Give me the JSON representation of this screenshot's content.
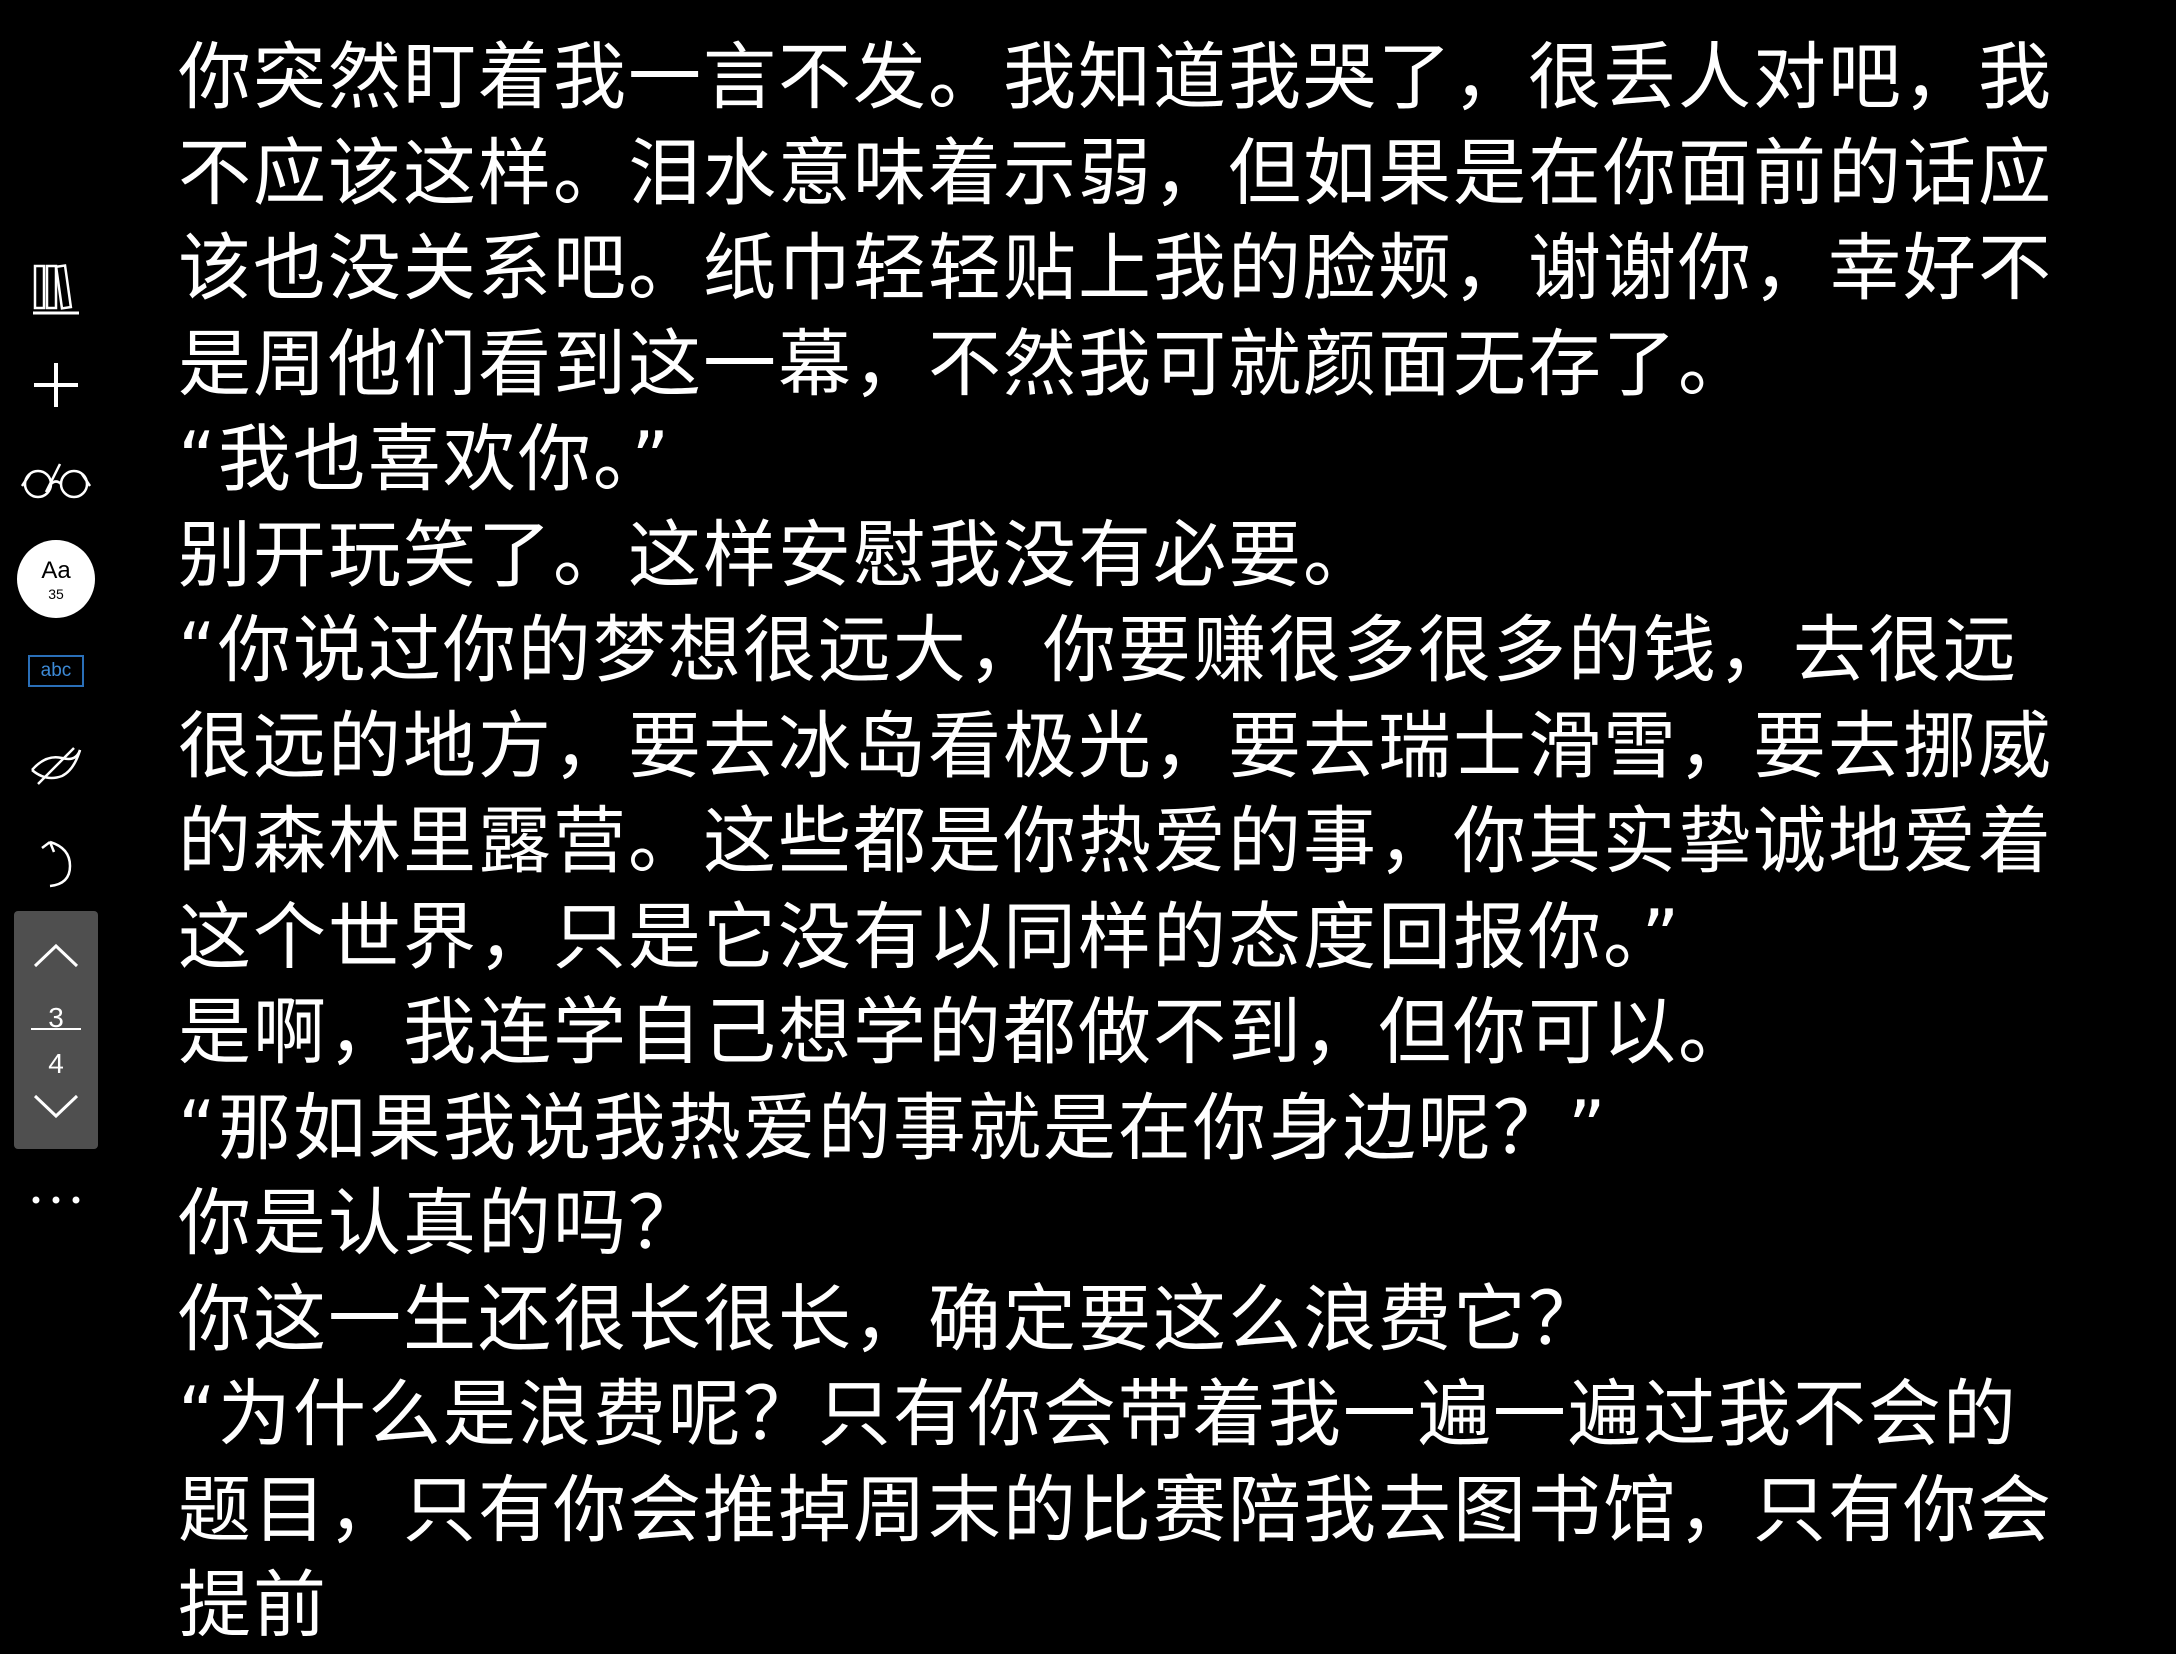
{
  "toolbar": {
    "items": [
      {
        "name": "library-icon"
      },
      {
        "name": "add-icon"
      },
      {
        "name": "glasses-icon"
      },
      {
        "name": "font-settings"
      },
      {
        "name": "abc-icon"
      },
      {
        "name": "annotate-icon"
      },
      {
        "name": "undo-icon"
      }
    ],
    "font_label": "Aa",
    "font_size": "35",
    "abc_label": "abc",
    "pager": {
      "current": "3",
      "total": "4"
    },
    "more_label": "···"
  },
  "content": {
    "paragraphs": [
      "你突然盯着我一言不发。我知道我哭了，很丢人对吧，我不应该这样。泪水意味着示弱，但如果是在你面前的话应该也没关系吧。纸巾轻轻贴上我的脸颊，谢谢你，幸好不是周他们看到这一幕，不然我可就颜面无存了。",
      "“我也喜欢你。”",
      "别开玩笑了。这样安慰我没有必要。",
      "“你说过你的梦想很远大，你要赚很多很多的钱，去很远很远的地方，要去冰岛看极光，要去瑞士滑雪，要去挪威的森林里露营。这些都是你热爱的事，你其实挚诚地爱着这个世界，只是它没有以同样的态度回报你。”",
      "是啊，我连学自己想学的都做不到，但你可以。",
      "“那如果我说我热爱的事就是在你身边呢？”",
      "你是认真的吗？",
      "你这一生还很长很长，确定要这么浪费它？",
      "“为什么是浪费呢？只有你会带着我一遍一遍过我不会的题目，只有你会推掉周末的比赛陪我去图书馆，只有你会提前"
    ]
  }
}
